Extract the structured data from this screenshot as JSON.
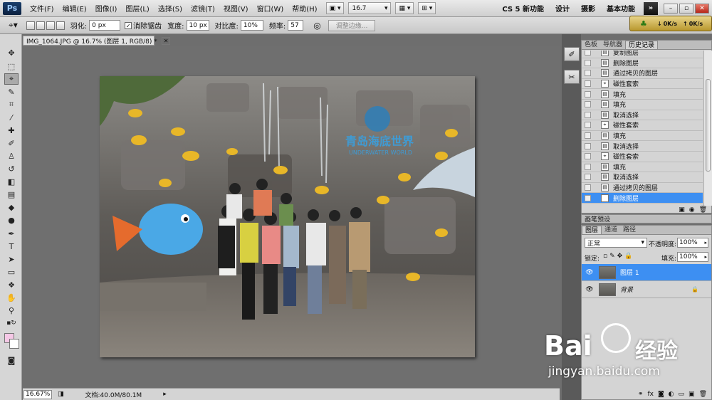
{
  "app": {
    "logo": "Ps"
  },
  "menu": {
    "items": [
      "文件(F)",
      "编辑(E)",
      "图像(I)",
      "图层(L)",
      "选择(S)",
      "滤镜(T)",
      "视图(V)",
      "窗口(W)",
      "帮助(H)"
    ],
    "zoom": "16.7",
    "workspaces": [
      "CS 5 新功能",
      "设计",
      "摄影",
      "基本功能"
    ],
    "more": "»"
  },
  "speed": {
    "down": "0K/s",
    "up": "0K/s"
  },
  "options": {
    "feather_label": "羽化:",
    "feather_value": "0 px",
    "antialias_label": "消除锯齿",
    "width_label": "宽度:",
    "width_value": "10 px",
    "contrast_label": "对比度:",
    "contrast_value": "10%",
    "frequency_label": "频率:",
    "frequency_value": "57",
    "refine_edge": "调整边缘..."
  },
  "document": {
    "tab_title": "IMG_1064.JPG @ 16.7% (图层 1, RGB/8) *"
  },
  "photo": {
    "sign_text": "青岛海底世界",
    "sign_sub": "UNDERWATER WORLD"
  },
  "status": {
    "zoom": "16.67%",
    "doc_info": "文档:40.0M/80.1M"
  },
  "history": {
    "tabs": [
      "色板",
      "导航器",
      "历史记录"
    ],
    "rows": [
      {
        "label": "复制图层",
        "icon": "layer"
      },
      {
        "label": "删除图层",
        "icon": "layer"
      },
      {
        "label": "通过拷贝的图层",
        "icon": "layer"
      },
      {
        "label": "磁性套索",
        "icon": "lasso"
      },
      {
        "label": "填充",
        "icon": "layer"
      },
      {
        "label": "填充",
        "icon": "layer"
      },
      {
        "label": "取消选择",
        "icon": "layer"
      },
      {
        "label": "磁性套索",
        "icon": "lasso"
      },
      {
        "label": "填充",
        "icon": "layer"
      },
      {
        "label": "取消选择",
        "icon": "layer"
      },
      {
        "label": "磁性套索",
        "icon": "lasso"
      },
      {
        "label": "填充",
        "icon": "layer"
      },
      {
        "label": "取消选择",
        "icon": "layer"
      },
      {
        "label": "通过拷贝的图层",
        "icon": "layer"
      },
      {
        "label": "删除图层",
        "icon": "layer",
        "selected": true
      }
    ]
  },
  "brush_presets": {
    "title": "画笔预设"
  },
  "layers": {
    "tabs": [
      "图层",
      "通道",
      "路径"
    ],
    "blend_mode": "正常",
    "opacity_label": "不透明度:",
    "opacity_value": "100%",
    "lock_label": "锁定:",
    "fill_label": "填充:",
    "fill_value": "100%",
    "rows": [
      {
        "name": "图层 1",
        "selected": true
      },
      {
        "name": "背景",
        "locked": true
      }
    ]
  },
  "watermark": {
    "brand": "Bai",
    "brand2": "经验",
    "url": "jingyan.baidu.com"
  },
  "colors": {
    "selection": "#3d8ff2",
    "fish": "#4aa8e6"
  }
}
